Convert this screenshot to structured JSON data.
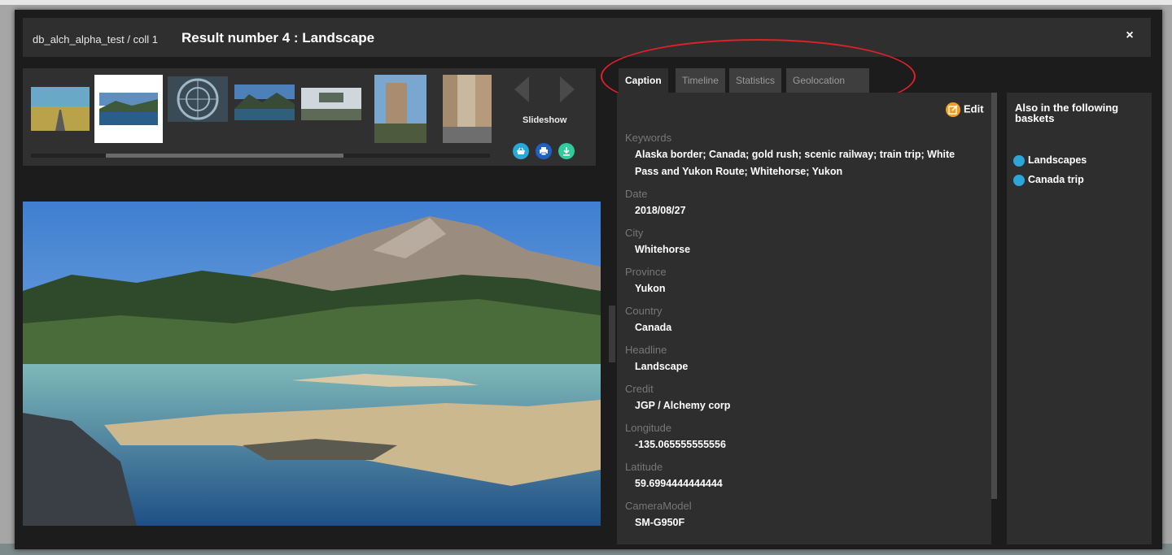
{
  "header": {
    "breadcrumb": "db_alch_alpha_test / coll 1",
    "title": "Result number 4 : Landscape",
    "close_label": "×"
  },
  "thumbnails": {
    "selected_index": 1,
    "scroll_fraction": 0.16,
    "slideshow_label": "Slideshow",
    "actions": [
      "basket-icon",
      "print-icon",
      "download-icon"
    ]
  },
  "tabs": [
    {
      "label": "Caption",
      "active": true
    },
    {
      "label": "Timeline",
      "active": false
    },
    {
      "label": "Statistics",
      "active": false
    },
    {
      "label": "Geolocation",
      "active": false
    }
  ],
  "caption": {
    "edit_label": "Edit",
    "fields": [
      {
        "label": "Keywords",
        "value": "Alaska border; Canada; gold rush; scenic railway; train trip; White Pass and Yukon Route; Whitehorse; Yukon"
      },
      {
        "label": "Date",
        "value": "2018/08/27"
      },
      {
        "label": "City",
        "value": "Whitehorse"
      },
      {
        "label": "Province",
        "value": "Yukon"
      },
      {
        "label": "Country",
        "value": "Canada"
      },
      {
        "label": "Headline",
        "value": "Landscape"
      },
      {
        "label": "Credit",
        "value": "JGP / Alchemy corp"
      },
      {
        "label": "Longitude",
        "value": "-135.065555555556"
      },
      {
        "label": "Latitude",
        "value": "59.6994444444444"
      },
      {
        "label": "CameraModel",
        "value": "SM-G950F"
      }
    ]
  },
  "baskets": {
    "title": "Also in the following baskets",
    "items": [
      "Landscapes",
      "Canada trip"
    ]
  },
  "colors": {
    "accent_blue": "#2aa6d8",
    "edit_orange": "#f0a020",
    "annotation_red": "#e0202a",
    "download_green": "#2ecc9a"
  }
}
